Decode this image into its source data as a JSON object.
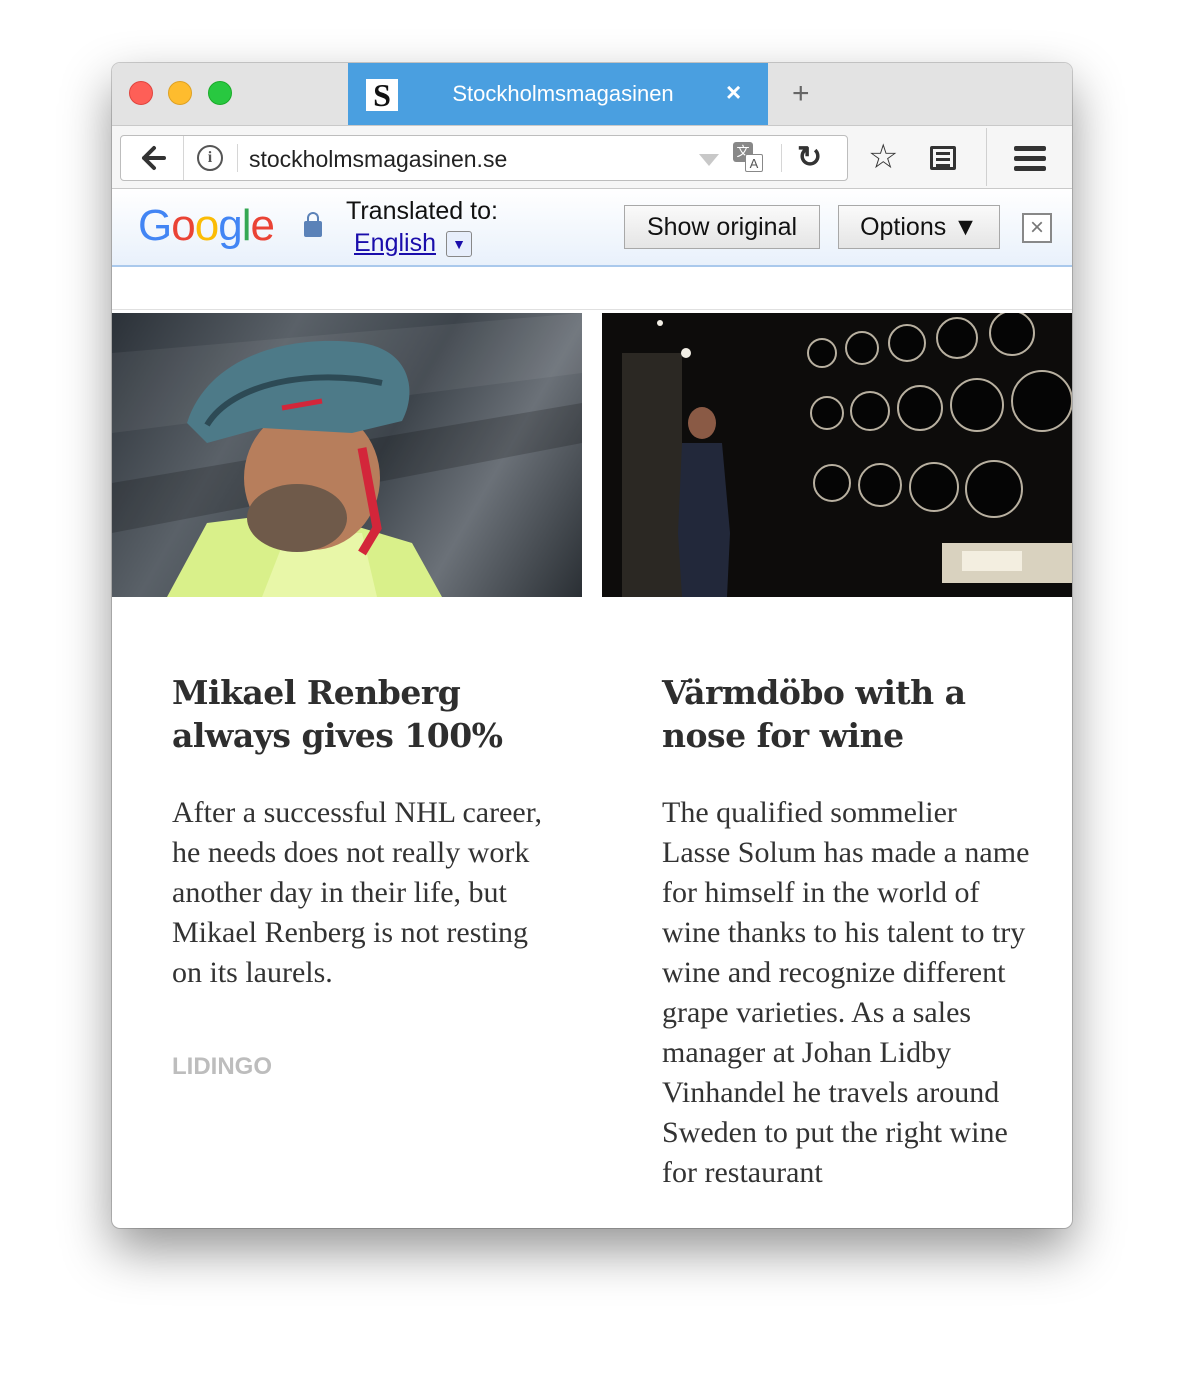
{
  "browser": {
    "tab": {
      "favicon_letter": "S",
      "title": "Stockholmsmagasinen",
      "close": "×"
    },
    "new_tab": "+",
    "url": "stockholmsmagasinen.se",
    "back_glyph": "🡐",
    "info_glyph": "i",
    "reload_glyph": "↻",
    "star_glyph": "☆"
  },
  "translate_bar": {
    "logo_letters": [
      "G",
      "o",
      "o",
      "g",
      "l",
      "e"
    ],
    "translated_to_label": "Translated to:",
    "language": "English",
    "language_dropdown": "▼",
    "show_original": "Show original",
    "options": "Options ▼",
    "close": "×"
  },
  "articles": [
    {
      "title": "Mikael Renberg always gives 100%",
      "body": "After a successful NHL career, he needs does not really work another day in their life, but Mikael Renberg is not resting on its laurels.",
      "tag": "LIDINGO",
      "image": "cyclist-helmet-photo"
    },
    {
      "title": "Värmdöbo with a nose for wine",
      "body": "The qualified sommelier Lasse Solum has made a name for himself in the world of wine thanks to his talent to try wine and recognize different grape varieties. As a sales manager at Johan Lidby Vinhandel he travels around Sweden to put the right wine for restaurant",
      "image": "wine-cellar-photo"
    }
  ],
  "colors": {
    "tab_active": "#4a9fe0",
    "link": "#1a0dab",
    "tag": "#bdbdbd"
  }
}
